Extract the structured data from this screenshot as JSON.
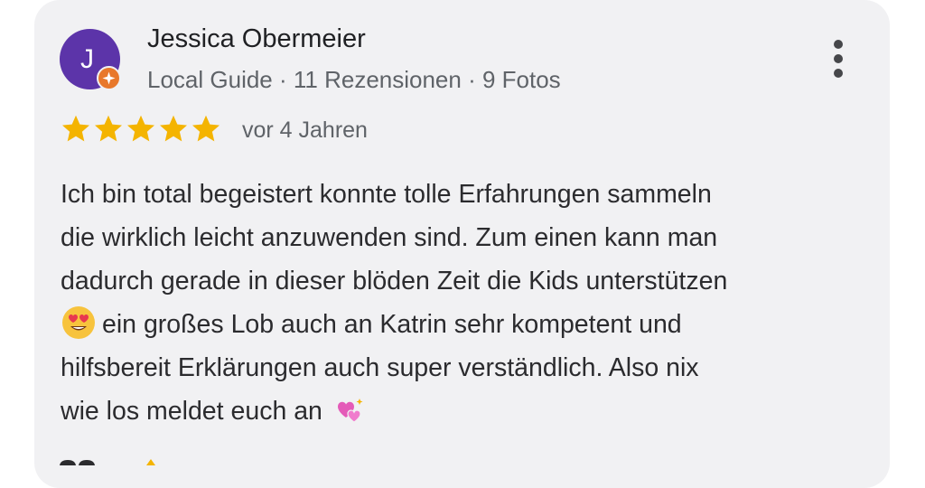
{
  "reviewer": {
    "avatar_initial": "J",
    "name": "Jessica Obermeier",
    "meta": "Local Guide · 11 Rezensionen · 9 Fotos"
  },
  "review": {
    "stars": 5,
    "max_stars": 5,
    "date": "vor 4 Jahren",
    "lines": {
      "l1": "Ich bin total begeistert konnte tolle Erfahrungen sammeln",
      "l2": "die wirklich leicht anzuwenden sind. Zum einen kann man",
      "l3": "dadurch gerade in dieser blöden Zeit die Kids unterstützen",
      "l4": "ein großes Lob auch an Katrin sehr kompetent und",
      "l5": "hilfsbereit Erklärungen auch super verständlich. Also nix",
      "l6": "wie los meldet euch an"
    }
  },
  "icons": {
    "menu": "more-vert-icon",
    "badge": "local-guide-star-icon",
    "heart_eyes": "heart-eyes-emoji",
    "hearts": "two-hearts-emoji"
  },
  "colors": {
    "avatar": "#5c34a9",
    "star": "#f4b400",
    "badge": "#e8782b",
    "card": "#f1f1f3"
  }
}
